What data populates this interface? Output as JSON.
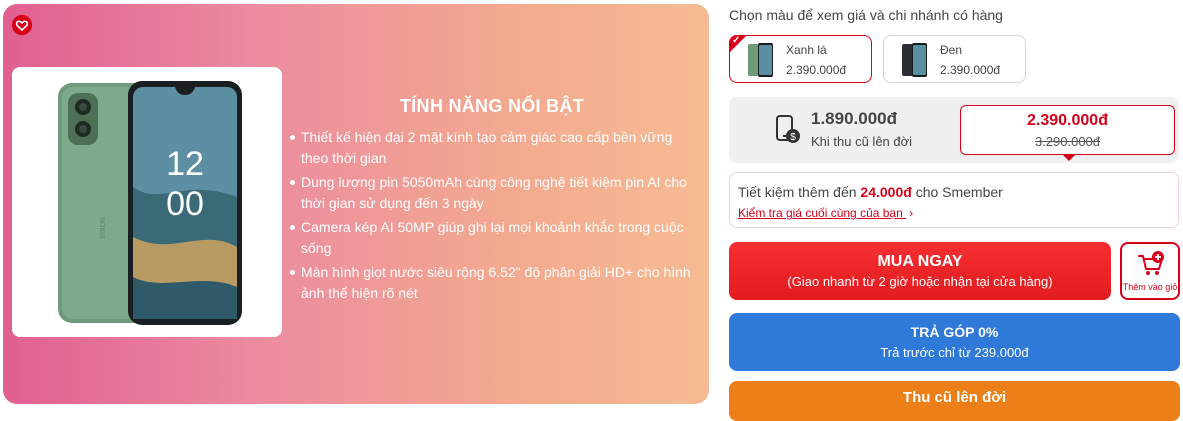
{
  "banner": {
    "favorite_icon": "heart-icon",
    "title": "TÍNH NĂNG NỔI BẬT",
    "features": [
      "Thiết kế hiện đại 2 mặt kính tạo cảm giác cao cấp bền vững theo thời gian",
      "Dung lượng pin 5050mAh cùng công nghệ tiết kiệm pin AI cho thời gian sử dụng đến 3 ngày",
      "Camera kép AI 50MP giúp ghi lại mọi khoảnh khắc trong cuộc sống",
      "Màn hình giọt nước siêu rộng 6.52\" độ phân giải HD+ cho hình ảnh thể hiện rõ nét"
    ],
    "phone_screen": {
      "hour": "12",
      "minute": "00",
      "brand": "NOKIA"
    },
    "gradient_colors": [
      "#e06090",
      "#f6bb93"
    ]
  },
  "colors": {
    "title": "Chọn màu để xem giá và chi nhánh có hàng",
    "options": [
      {
        "name": "Xanh lá",
        "price": "2.390.000đ",
        "selected": true,
        "swatch": "#6e9a7a"
      },
      {
        "name": "Đen",
        "price": "2.390.000đ",
        "selected": false,
        "swatch": "#2b2f33"
      }
    ]
  },
  "pricing": {
    "tradein_price": "1.890.000đ",
    "tradein_label": "Khi thu cũ lên đời",
    "price": "2.390.000đ",
    "old_price": "3.290.000đ",
    "accent": "#d70018"
  },
  "promo": {
    "text_prefix": "Tiết kiệm thêm đến",
    "amount": "24.000đ",
    "text_suffix": "cho Smember",
    "link": "Kiểm tra giá cuối cùng của bạn"
  },
  "actions": {
    "buy_now": "MUA NGAY",
    "buy_now_sub": "(Giao nhanh từ 2 giờ hoặc nhận tại cửa hàng)",
    "add_to_cart": "Thêm vào giỏ",
    "installment": "TRẢ GÓP 0%",
    "installment_sub": "Trả trước chỉ từ 239.000đ",
    "trade_in": "Thu cũ lên đời",
    "colors": {
      "buy": "#e11b1e",
      "installment": "#2f79d9",
      "tradein": "#ec7f17"
    }
  }
}
